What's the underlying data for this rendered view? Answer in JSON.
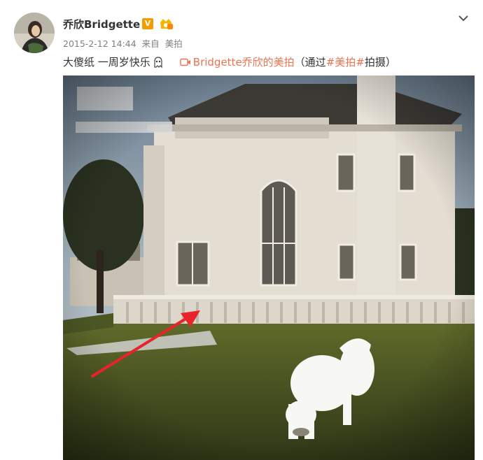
{
  "post": {
    "username": "乔欣Bridgette",
    "verified_badge": "V",
    "timestamp": "2015-2-12 14:44",
    "source_prefix": "来自",
    "source_app": "美拍",
    "text": "大傻纸 一周岁快乐",
    "video_link": "Bridgette乔欣的美拍",
    "via_open": "（通过",
    "hashtag": "#美拍#",
    "via_close": "拍摄）"
  },
  "icons": {
    "avatar": "avatar",
    "verified": "verified-v-badge",
    "member": "member-crown-icon",
    "expand": "chevron-down-icon",
    "emoji": "ghost-emoji-icon",
    "video": "video-link-icon"
  },
  "colors": {
    "link": "#eb7350",
    "badge": "#f59b00",
    "meta": "#808080",
    "arrow": "#e8242a"
  }
}
